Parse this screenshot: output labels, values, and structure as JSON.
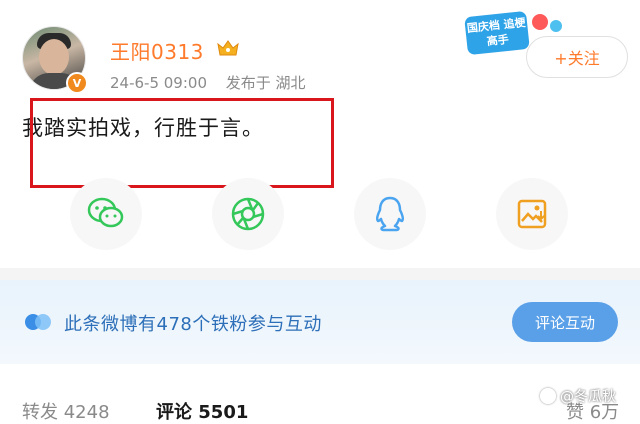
{
  "post": {
    "username": "王阳0313",
    "meta": {
      "date": "24-6-5 09:00",
      "location": "发布于 湖北"
    },
    "verified_badge": "V",
    "content": "我踏实拍戏，行胜于言。",
    "follow_label": "+关注",
    "promo": {
      "text": "国庆档 追梗高手"
    },
    "share_icons": [
      "wechat-icon",
      "moments-icon",
      "qq-icon",
      "save-image-icon"
    ],
    "colors": {
      "username": "#ff7a2a",
      "highlight": "#d8161b",
      "wechat": "#34c759",
      "qq": "#4aa4f0",
      "save": "#f0a020"
    }
  },
  "fan_banner": {
    "text": "此条微博有478个铁粉参与互动",
    "button_label": "评论互动"
  },
  "stats": {
    "repost_label": "转发",
    "repost_count": "4248",
    "comment_label": "评论",
    "comment_count": "5501",
    "like_label": "赞",
    "like_count": "6万"
  },
  "watermark": "@冬瓜秋"
}
